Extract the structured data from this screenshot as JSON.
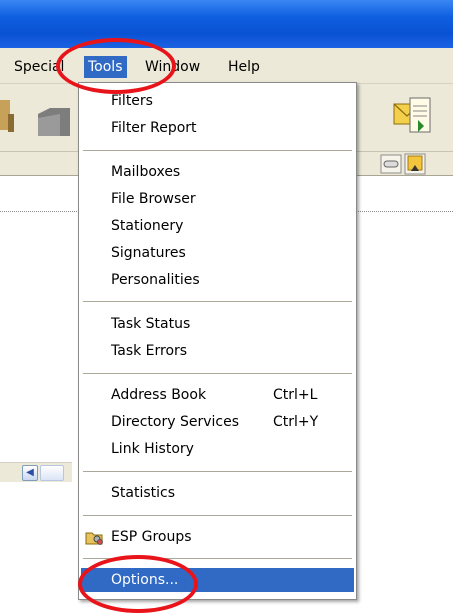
{
  "menubar": {
    "items": [
      {
        "label": "Special"
      },
      {
        "label": "Tools"
      },
      {
        "label": "Window"
      },
      {
        "label": "Help"
      }
    ]
  },
  "tools_menu": {
    "filters": "Filters",
    "filter_report": "Filter Report",
    "mailboxes": "Mailboxes",
    "file_browser": "File Browser",
    "stationery": "Stationery",
    "signatures": "Signatures",
    "personalities": "Personalities",
    "task_status": "Task Status",
    "task_errors": "Task Errors",
    "address_book": "Address Book",
    "address_book_shortcut": "Ctrl+L",
    "directory_services": "Directory Services",
    "directory_services_shortcut": "Ctrl+Y",
    "link_history": "Link History",
    "statistics": "Statistics",
    "esp_groups": "ESP Groups",
    "options": "Options..."
  },
  "colors": {
    "highlight": "#316ac5",
    "annotation": "#e8141a",
    "chrome": "#ece9d8",
    "titlebar": "#0a52d4"
  },
  "icons": [
    "address-icon",
    "folder-icon",
    "mail-send-icon",
    "scroll-left-icon",
    "esp-groups-icon"
  ]
}
